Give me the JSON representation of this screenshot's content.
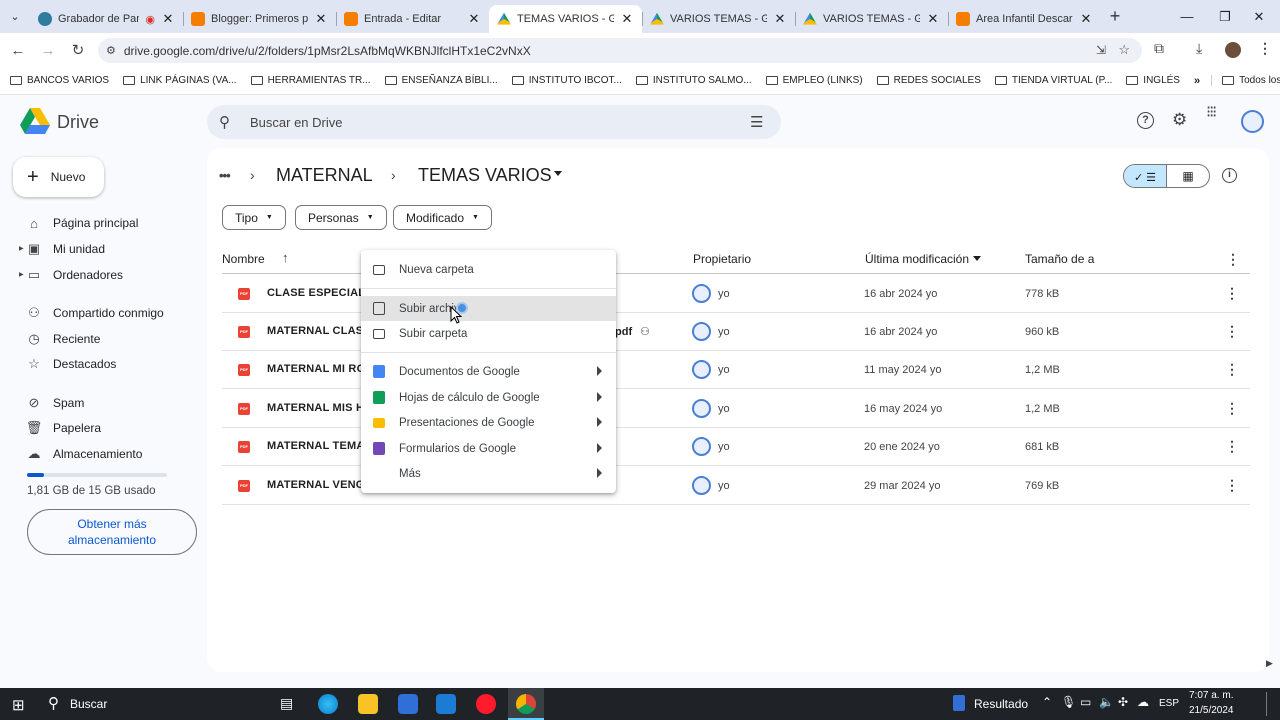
{
  "browser": {
    "tabs": [
      {
        "title": "Grabador de Pantalla",
        "fav": "#2e7d9e"
      },
      {
        "title": "Blogger: Primeros pasos",
        "fav": "#f57d00"
      },
      {
        "title": "Entrada - Editar",
        "fav": "#f57d00"
      },
      {
        "title": "TEMAS VARIOS - Google Drive",
        "fav": "drive",
        "active": true
      },
      {
        "title": "VARIOS TEMAS - Google Drive",
        "fav": "drive"
      },
      {
        "title": "VARIOS TEMAS - Google Drive",
        "fav": "drive"
      },
      {
        "title": "Area Infantil Descargables",
        "fav": "#f57d00"
      }
    ],
    "url": "drive.google.com/drive/u/2/folders/1pMsr2LsAfbMqWKBNJlfclHTx1eC2vNxX",
    "bookmarks": [
      "BANCOS VARIOS",
      "LINK PÁGINAS (VA...",
      "HERRAMIENTAS TR...",
      "ENSEÑANZA BÍBLI...",
      "INSTITUTO IBCOT...",
      "INSTITUTO SALMO...",
      "EMPLEO (LINKS)",
      "REDES SOCIALES",
      "TIENDA VIRTUAL (P...",
      "INGLÉS"
    ],
    "all_bookmarks": "Todos los marcadores"
  },
  "drive": {
    "logo": "Drive",
    "search_placeholder": "Buscar en Drive",
    "new_button": "Nuevo",
    "nav": [
      "Página principal",
      "Mi unidad",
      "Ordenadores",
      "Compartido conmigo",
      "Reciente",
      "Destacados",
      "Spam",
      "Papelera",
      "Almacenamiento"
    ],
    "storage_used": "1,81 GB de 15 GB usado",
    "storage_fraction": 0.12,
    "get_storage": "Obtener más almacenamiento",
    "breadcrumb": {
      "ellipsis": "•••",
      "parent": "MATERNAL",
      "current": "TEMAS VARIOS"
    },
    "filters": [
      "Tipo",
      "Personas",
      "Modificado"
    ],
    "columns": {
      "name": "Nombre",
      "owner": "Propietario",
      "modified": "Última modificación",
      "size": "Tamaño de a"
    },
    "files": [
      {
        "name": "CLASE ESPECIAL",
        "owner": "yo",
        "modified": "16 abr 2024 yo",
        "size": "778 kB"
      },
      {
        "name": "MATERNAL CLASE",
        "owner": "yo",
        "modified": "16 abr 2024 yo",
        "size": "960 kB",
        "suffix": "pdf"
      },
      {
        "name": "MATERNAL MI RO",
        "owner": "yo",
        "modified": "11 may 2024 yo",
        "size": "1,2 MB"
      },
      {
        "name": "MATERNAL MIS H",
        "owner": "yo",
        "modified": "16 may 2024 yo",
        "size": "1,2 MB"
      },
      {
        "name": "MATERNAL TEMA",
        "owner": "yo",
        "modified": "20 ene 2024 yo",
        "size": "681 kB"
      },
      {
        "name": "MATERNAL VENG",
        "owner": "yo",
        "modified": "29 mar 2024 yo",
        "size": "769 kB"
      }
    ],
    "menu": {
      "new_folder": "Nueva carpeta",
      "upload_file": "Subir archivo",
      "upload_folder": "Subir carpeta",
      "docs": "Documentos de Google",
      "sheets": "Hojas de cálculo de Google",
      "slides": "Presentaciones de Google",
      "forms": "Formularios de Google",
      "more": "Más"
    }
  },
  "taskbar": {
    "search": "Buscar",
    "result": "Resultado",
    "lang": "ESP",
    "time": "7:07 a. m.",
    "date": "21/5/2024"
  }
}
